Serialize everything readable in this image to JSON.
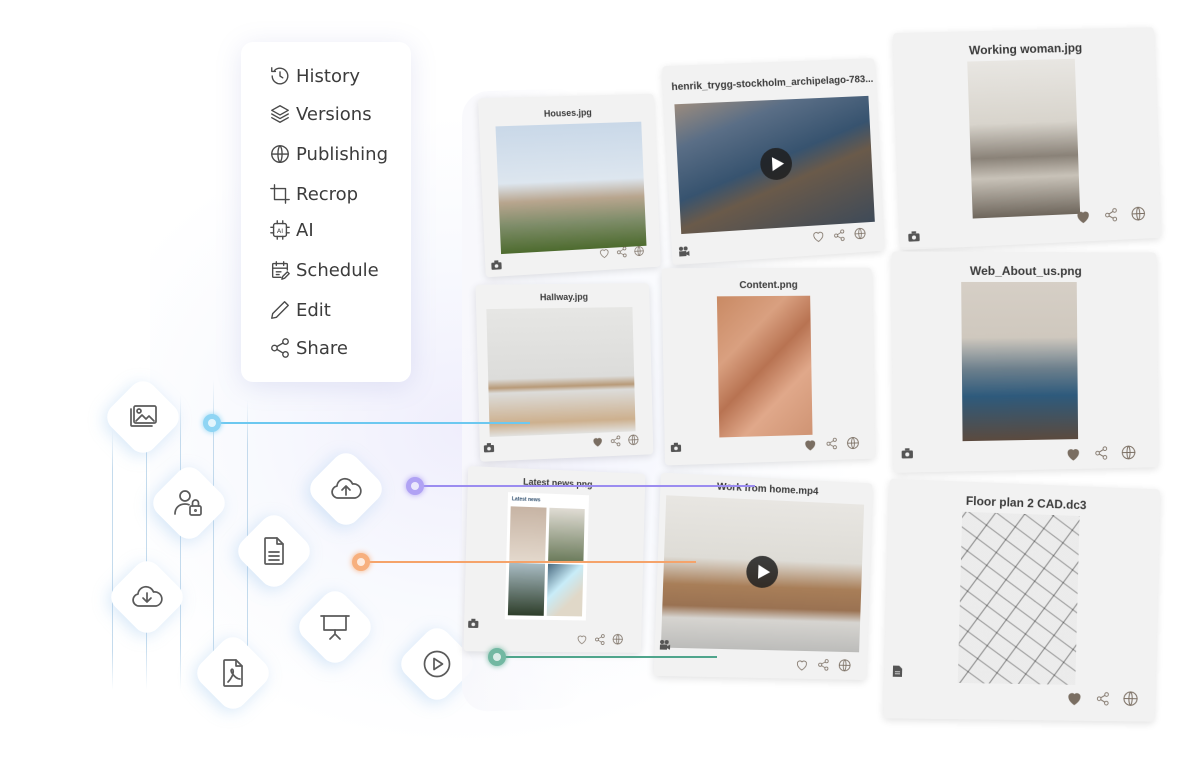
{
  "menu": {
    "items": [
      {
        "label": "History",
        "icon": "history-icon"
      },
      {
        "label": "Versions",
        "icon": "layers-icon"
      },
      {
        "label": "Publishing",
        "icon": "globe-icon"
      },
      {
        "label": "Recrop",
        "icon": "crop-icon"
      },
      {
        "label": "AI",
        "icon": "ai-chip-icon"
      },
      {
        "label": "Schedule",
        "icon": "schedule-icon"
      },
      {
        "label": "Edit",
        "icon": "pencil-icon"
      },
      {
        "label": "Share",
        "icon": "share-icon"
      }
    ]
  },
  "asset_types": [
    {
      "name": "image-gallery",
      "icon": "images-icon"
    },
    {
      "name": "user-access",
      "icon": "user-lock-icon"
    },
    {
      "name": "cloud-upload",
      "icon": "cloud-upload-icon"
    },
    {
      "name": "document",
      "icon": "document-icon"
    },
    {
      "name": "cloud-download",
      "icon": "cloud-download-icon"
    },
    {
      "name": "presentation",
      "icon": "presentation-icon"
    },
    {
      "name": "pdf",
      "icon": "pdf-icon"
    },
    {
      "name": "video",
      "icon": "play-circle-icon"
    }
  ],
  "connector_colors": {
    "blue": "#6cc8f0",
    "purple": "#9b8cf0",
    "orange": "#f5a36a",
    "green": "#4fa58c"
  },
  "gallery": {
    "cards": [
      {
        "title": "Houses.jpg",
        "type": "image",
        "liked": false
      },
      {
        "title": "henrik_trygg-stockholm_archipelago-783...",
        "type": "video",
        "liked": false
      },
      {
        "title": "Working woman.jpg",
        "type": "image",
        "liked": true
      },
      {
        "title": "Hallway.jpg",
        "type": "image",
        "liked": true
      },
      {
        "title": "Content.png",
        "type": "image",
        "liked": true
      },
      {
        "title": "Web_About_us.png",
        "type": "image",
        "liked": true
      },
      {
        "title": "Latest news.png",
        "type": "image",
        "liked": false,
        "inner_heading": "Latest news"
      },
      {
        "title": "Work from home.mp4",
        "type": "video",
        "liked": false
      },
      {
        "title": "Floor plan 2 CAD.dc3",
        "type": "document",
        "liked": true
      }
    ]
  },
  "colors": {
    "action_icon": "#7a6e62",
    "card_bg": "#f2f2f2",
    "text": "#3a3a3a"
  }
}
